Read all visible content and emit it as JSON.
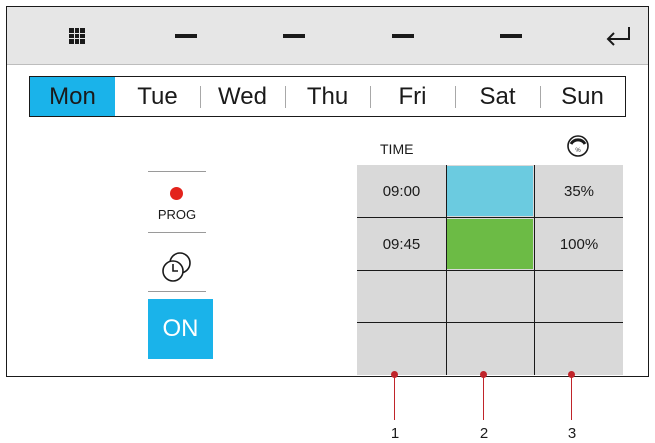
{
  "toolbar": {
    "buttons": [
      {
        "name": "grid-menu",
        "icon": "grid-icon"
      },
      {
        "name": "dash-1",
        "icon": "dash-icon"
      },
      {
        "name": "dash-2",
        "icon": "dash-icon"
      },
      {
        "name": "dash-3",
        "icon": "dash-icon"
      },
      {
        "name": "dash-4",
        "icon": "dash-icon"
      },
      {
        "name": "back",
        "icon": "return-arrow-icon"
      }
    ]
  },
  "days": {
    "items": [
      "Mon",
      "Tue",
      "Wed",
      "Thu",
      "Fri",
      "Sat",
      "Sun"
    ],
    "selected": "Mon"
  },
  "controls": {
    "prog_label": "PROG",
    "prog_dot_color": "#e3231c",
    "on_label": "ON",
    "accent_color": "#1ab3ea"
  },
  "schedule": {
    "time_header": "TIME",
    "level_header_icon": "percent-dial-icon",
    "rows": [
      {
        "time": "09:00",
        "color": "#6bcbe0",
        "level": "35%"
      },
      {
        "time": "09:45",
        "color": "#6cbb45",
        "level": "100%"
      },
      {
        "time": "",
        "color": "",
        "level": ""
      },
      {
        "time": "",
        "color": "",
        "level": ""
      }
    ]
  },
  "callouts": [
    "1",
    "2",
    "3"
  ]
}
